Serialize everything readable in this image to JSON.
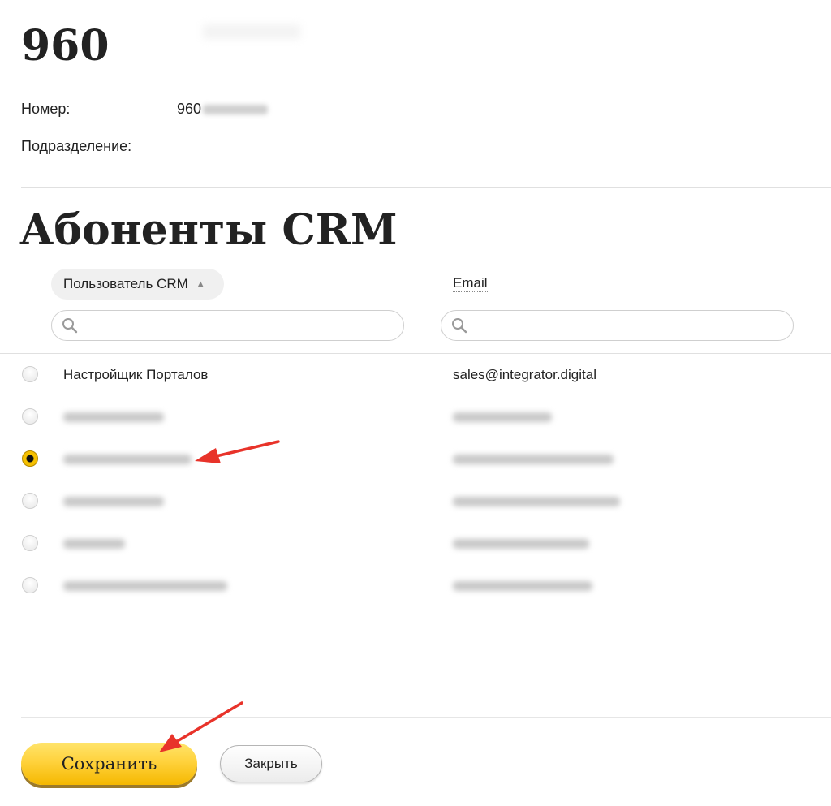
{
  "header": {
    "number_title": "960",
    "number_label": "Номер:",
    "number_value_prefix": "960",
    "division_label": "Подразделение:"
  },
  "section": {
    "title": "Абоненты CRM"
  },
  "table": {
    "columns": {
      "user": "Пользователь CRM",
      "email": "Email"
    },
    "rows": [
      {
        "name": "Настройщик Порталов",
        "email": "sales@integrator.digital",
        "selected": false,
        "blurred": false
      },
      {
        "name": "",
        "email": "",
        "selected": false,
        "blurred": true
      },
      {
        "name": "",
        "email": "",
        "selected": true,
        "blurred": true
      },
      {
        "name": "",
        "email": "",
        "selected": false,
        "blurred": true
      },
      {
        "name": "",
        "email": "",
        "selected": false,
        "blurred": true
      },
      {
        "name": "",
        "email": "",
        "selected": false,
        "blurred": true
      }
    ]
  },
  "buttons": {
    "save": "Сохранить",
    "close": "Закрыть"
  },
  "colors": {
    "save_button": "#ffd23c",
    "radio_selected": "#f7c400",
    "annotation_arrow": "#e8332a"
  },
  "icons": {
    "search": "magnifier-icon",
    "sort": "sort-up-icon"
  }
}
